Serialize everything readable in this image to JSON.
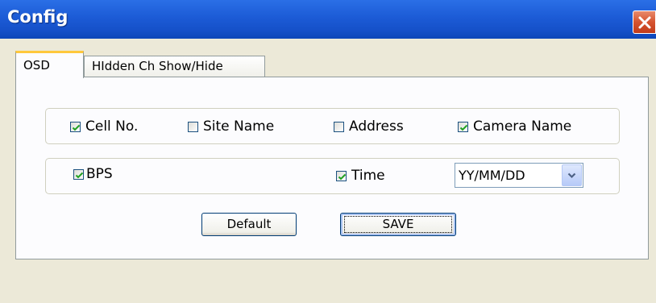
{
  "window": {
    "title": "Config",
    "close_icon": "close-icon"
  },
  "tabs": [
    {
      "label": "OSD",
      "active": true
    },
    {
      "label": "HIdden Ch Show/Hide",
      "active": false
    }
  ],
  "osd": {
    "row1": [
      {
        "label": "Cell No.",
        "checked": true
      },
      {
        "label": "Site Name",
        "checked": false
      },
      {
        "label": "Address",
        "checked": false
      },
      {
        "label": "Camera Name",
        "checked": true
      }
    ],
    "row2": [
      {
        "label": "BPS",
        "checked": true
      },
      {
        "label": "Time",
        "checked": true
      }
    ],
    "date_format": {
      "selected": "YY/MM/DD"
    }
  },
  "buttons": {
    "default_label": "Default",
    "save_label": "SAVE"
  },
  "colors": {
    "titlebar": "#1c5bd6",
    "window_bg": "#ece9d8",
    "active_tab_highlight": "#ffc83c",
    "checkmark": "#21a121",
    "close_button": "#d6532f"
  }
}
